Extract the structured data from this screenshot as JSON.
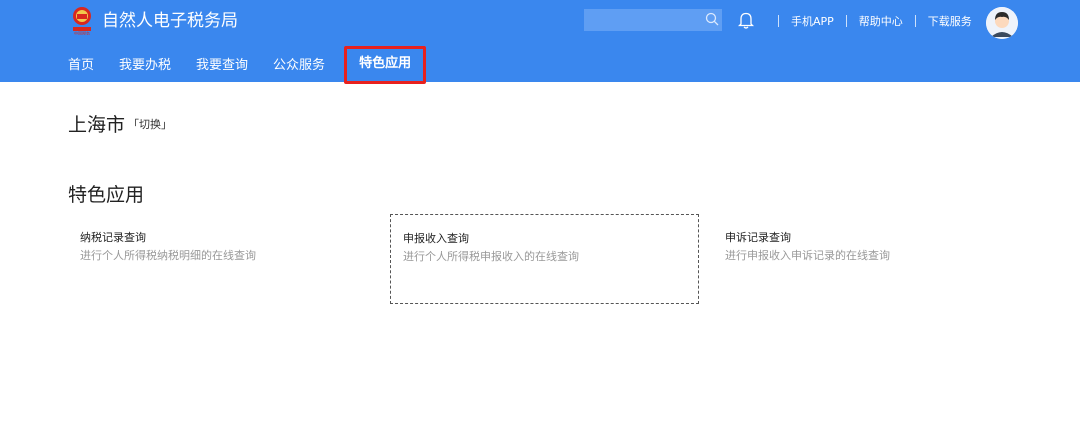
{
  "header": {
    "site_title": "自然人电子税务局",
    "search_placeholder": "",
    "links": [
      "手机APP",
      "帮助中心",
      "下载服务"
    ],
    "accent_color": "#3a87ee",
    "highlight_color": "#e8211e"
  },
  "nav": {
    "items": [
      {
        "label": "首页"
      },
      {
        "label": "我要办税"
      },
      {
        "label": "我要查询"
      },
      {
        "label": "公众服务"
      },
      {
        "label": "特色应用"
      }
    ],
    "active": "特色应用"
  },
  "location": {
    "city": "上海市",
    "switch_label": "「切换」"
  },
  "section": {
    "title": "特色应用",
    "cards": [
      {
        "title": "纳税记录查询",
        "desc": "进行个人所得税纳税明细的在线查询"
      },
      {
        "title": "申报收入查询",
        "desc": "进行个人所得税申报收入的在线查询"
      },
      {
        "title": "申诉记录查询",
        "desc": "进行申报收入申诉记录的在线查询"
      }
    ]
  }
}
